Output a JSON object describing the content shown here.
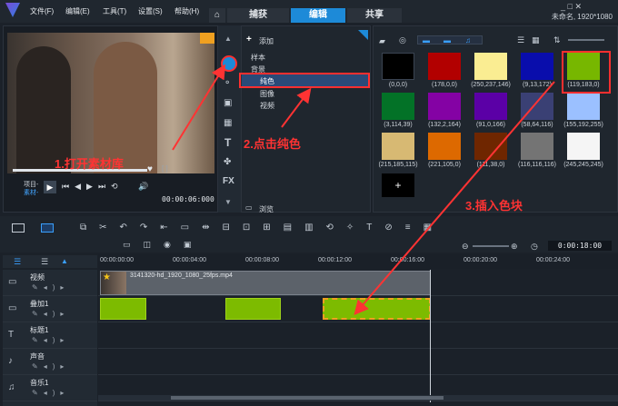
{
  "title_bar": {
    "menu": [
      "文件(F)",
      "编辑(E)",
      "工具(T)",
      "设置(S)",
      "帮助(H)"
    ],
    "tabs": [
      "捕获",
      "编辑",
      "共享"
    ],
    "active_tab": "编辑",
    "project_info": "未命名, 1920*1080"
  },
  "preview": {
    "mode_labels": [
      "项目-",
      "素材-"
    ],
    "timecode": "00:00:06:000"
  },
  "library": {
    "add_label": "添加",
    "tree": {
      "sample": "样本",
      "background": "背景",
      "solid_color": "纯色",
      "image": "图像",
      "video": "视频"
    },
    "browse_label": "浏览",
    "swatches": [
      {
        "label": "(0,0,0)",
        "color": "#000000"
      },
      {
        "label": "(178,0,0)",
        "color": "#b20000"
      },
      {
        "label": "(250,237,146)",
        "color": "#faed92"
      },
      {
        "label": "(9,13,172)",
        "color": "#090dac"
      },
      {
        "label": "(119,183,0)",
        "color": "#77b700"
      },
      {
        "label": "(3,114,39)",
        "color": "#037227"
      },
      {
        "label": "(132,2,164)",
        "color": "#8402a4"
      },
      {
        "label": "(91,0,166)",
        "color": "#5b00a6"
      },
      {
        "label": "(58,64,116)",
        "color": "#3a4074"
      },
      {
        "label": "(155,192,255)",
        "color": "#9bc0ff"
      },
      {
        "label": "(215,185,115)",
        "color": "#d7b973"
      },
      {
        "label": "(221,105,0)",
        "color": "#dd6900"
      },
      {
        "label": "(111,38,0)",
        "color": "#6f2600"
      },
      {
        "label": "(116,116,116)",
        "color": "#747474"
      },
      {
        "label": "(245,245,245)",
        "color": "#f5f5f5"
      }
    ],
    "add_swatch_symbol": "+"
  },
  "timeline": {
    "timecode": "0:00:18:00",
    "ruler_ticks": [
      "00:00:00:00",
      "00:00:04:00",
      "00:00:08:00",
      "00:00:12:00",
      "00:00:16:00",
      "00:00:20:00",
      "00:00:24:00"
    ],
    "tracks": [
      {
        "name": "视频"
      },
      {
        "name": "叠加1"
      },
      {
        "name": "标题1"
      },
      {
        "name": "声音"
      },
      {
        "name": "音乐1"
      }
    ],
    "video_clip_name": "3141320-hd_1920_1080_25fps.mp4"
  },
  "annotations": {
    "step1": "1.打开素材库",
    "step2": "2.点击纯色",
    "step3": "3.插入色块"
  },
  "colors": {
    "accent": "#1d8ad8",
    "annotation": "#ff3333",
    "clip_green": "#7dbb00"
  }
}
